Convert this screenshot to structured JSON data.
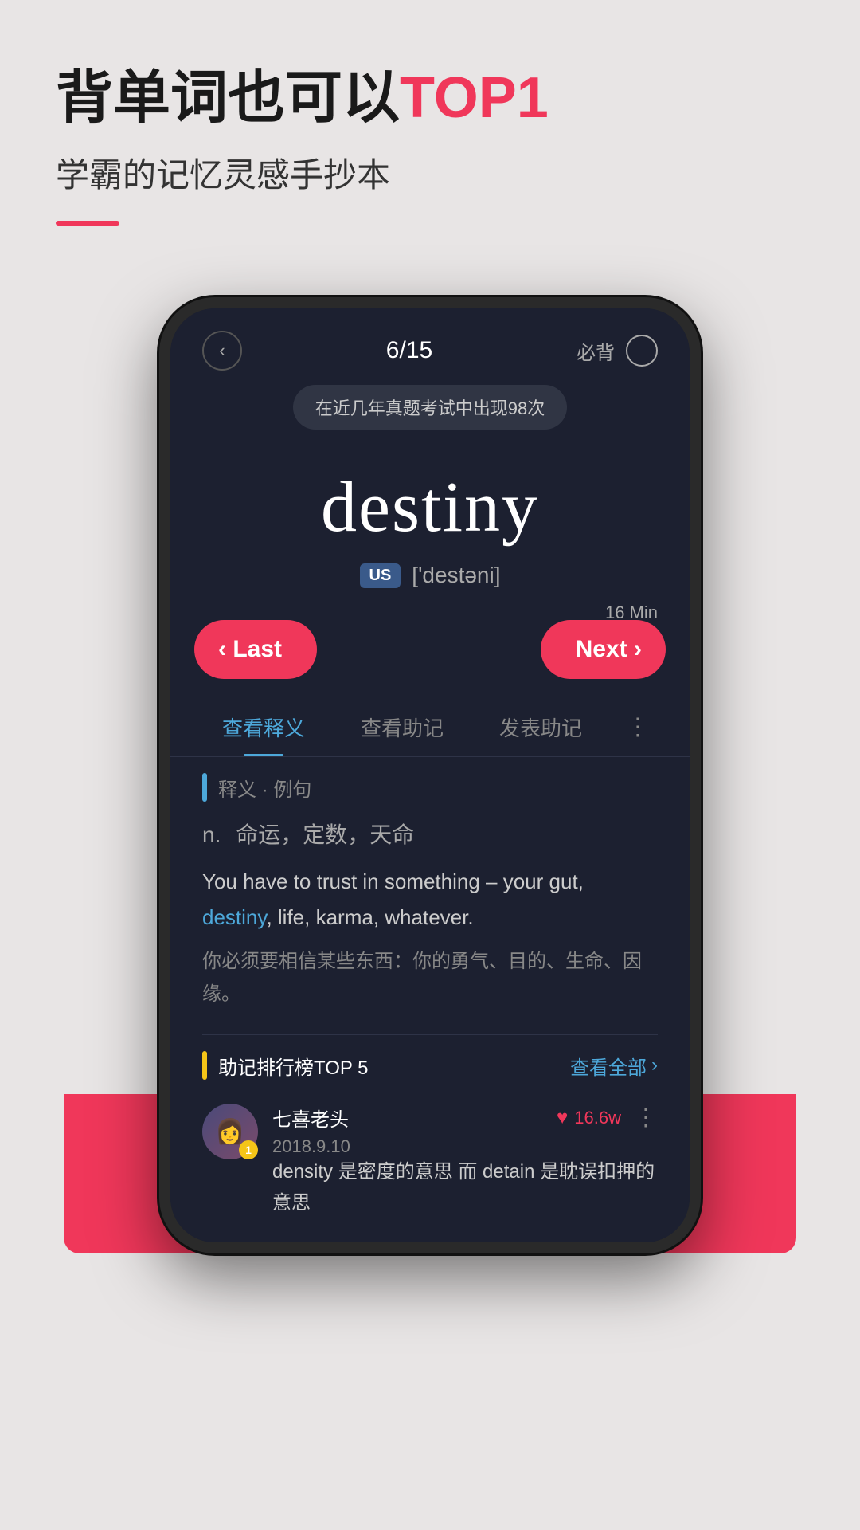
{
  "app": {
    "headline": "背单词也可以",
    "headline_highlight": "TOP1",
    "subtitle": "学霸的记忆灵感手抄本",
    "underline_visible": true
  },
  "phone": {
    "nav": {
      "back_label": "‹",
      "progress": "6/15",
      "must_memorize": "必背",
      "circle_empty": true
    },
    "tooltip": "在近几年真题考试中出现98次",
    "word": {
      "text": "destiny",
      "us_badge": "US",
      "phonetic": "['destəni]"
    },
    "time_label": "16 Min",
    "buttons": {
      "last_label": "‹ Last",
      "next_label": "Next ›"
    },
    "tabs": [
      {
        "label": "查看释义",
        "active": true
      },
      {
        "label": "查看助记",
        "active": false
      },
      {
        "label": "发表助记",
        "active": false
      }
    ],
    "tab_more": "⋮",
    "definition": {
      "section_label": "释义 · 例句",
      "pos": "n.",
      "meaning": "命运，定数，天命",
      "example_en_parts": [
        "You have to trust in something – your gut, ",
        "destiny",
        ", life, karma, whatever."
      ],
      "example_zh": "你必须要相信某些东西：你的勇气、目的、生命、因缘。"
    },
    "mnemonic": {
      "section_label": "助记排行榜TOP 5",
      "view_all": "查看全部",
      "entries": [
        {
          "rank": "1",
          "username": "七喜老头",
          "date": "2018.9.10",
          "likes": "16.6w",
          "content": "density 是密度的意思 而 detain 是耽误扣押的意思"
        }
      ]
    }
  }
}
